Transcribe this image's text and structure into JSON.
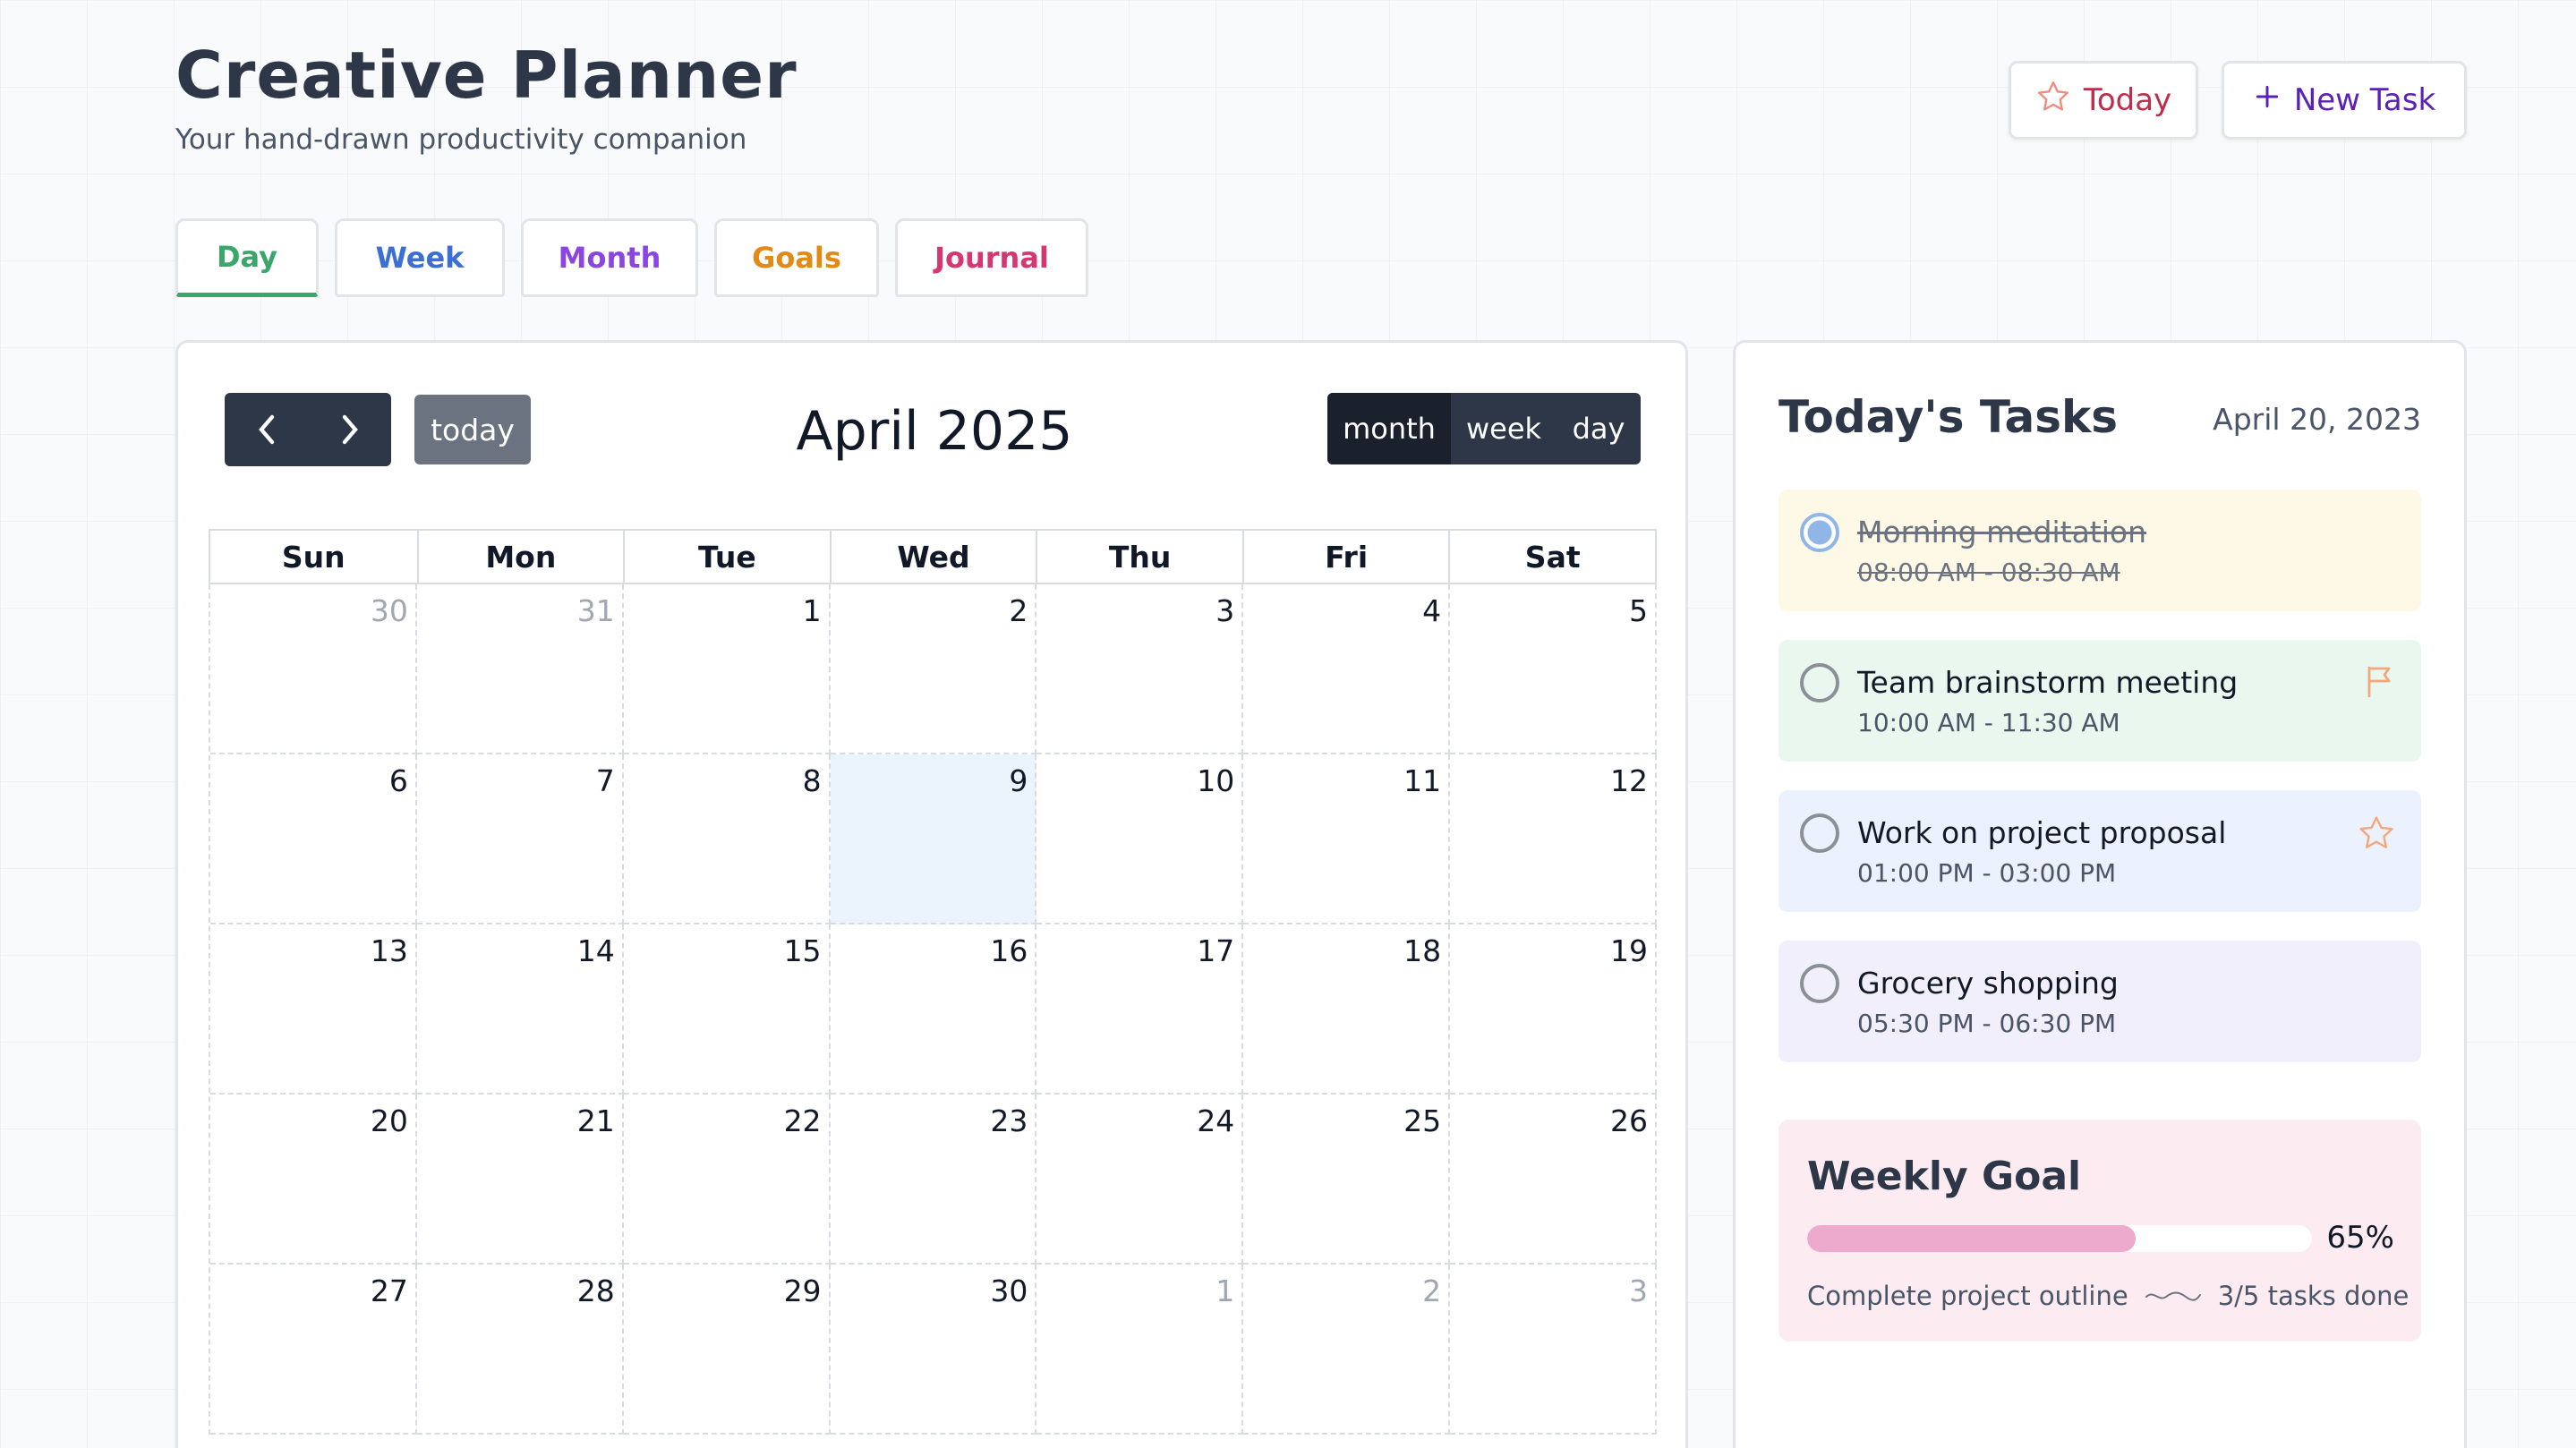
{
  "app": {
    "title": "Creative Planner",
    "subtitle": "Your hand-drawn productivity companion"
  },
  "header": {
    "today_label": "Today",
    "new_task_label": "New Task"
  },
  "tabs": [
    {
      "label": "Day",
      "active": true
    },
    {
      "label": "Week"
    },
    {
      "label": "Month"
    },
    {
      "label": "Goals"
    },
    {
      "label": "Journal"
    }
  ],
  "calendar": {
    "title": "April 2025",
    "today_label": "today",
    "views": [
      "month",
      "week",
      "day"
    ],
    "active_view": "month",
    "weekdays": [
      "Sun",
      "Mon",
      "Tue",
      "Wed",
      "Thu",
      "Fri",
      "Sat"
    ],
    "days": [
      {
        "n": "30",
        "other": true
      },
      {
        "n": "31",
        "other": true
      },
      {
        "n": "1"
      },
      {
        "n": "2"
      },
      {
        "n": "3"
      },
      {
        "n": "4"
      },
      {
        "n": "5"
      },
      {
        "n": "6"
      },
      {
        "n": "7"
      },
      {
        "n": "8"
      },
      {
        "n": "9",
        "highlight": true
      },
      {
        "n": "10"
      },
      {
        "n": "11"
      },
      {
        "n": "12"
      },
      {
        "n": "13"
      },
      {
        "n": "14"
      },
      {
        "n": "15"
      },
      {
        "n": "16"
      },
      {
        "n": "17"
      },
      {
        "n": "18"
      },
      {
        "n": "19"
      },
      {
        "n": "20"
      },
      {
        "n": "21"
      },
      {
        "n": "22"
      },
      {
        "n": "23"
      },
      {
        "n": "24"
      },
      {
        "n": "25"
      },
      {
        "n": "26"
      },
      {
        "n": "27"
      },
      {
        "n": "28"
      },
      {
        "n": "29"
      },
      {
        "n": "30"
      },
      {
        "n": "1",
        "other": true
      },
      {
        "n": "2",
        "other": true
      },
      {
        "n": "3",
        "other": true
      }
    ]
  },
  "tasks_panel": {
    "title": "Today's Tasks",
    "date": "April 20, 2023",
    "tasks": [
      {
        "name": "Morning meditation",
        "time": "08:00 AM - 08:30 AM",
        "done": true,
        "icon": ""
      },
      {
        "name": "Team brainstorm meeting",
        "time": "10:00 AM - 11:30 AM",
        "done": false,
        "icon": "flag-icon"
      },
      {
        "name": "Work on project proposal",
        "time": "01:00 PM - 03:00 PM",
        "done": false,
        "icon": "star-icon"
      },
      {
        "name": "Grocery shopping",
        "time": "05:30 PM - 06:30 PM",
        "done": false,
        "icon": ""
      }
    ]
  },
  "weekly_goal": {
    "title": "Weekly Goal",
    "progress": 0.65,
    "percent_label": "65%",
    "description": "Complete project outline",
    "status": "3/5 tasks done"
  },
  "colors": {
    "day": "#3aa66b",
    "week": "#3b6fd6",
    "month": "#8b45e0",
    "goals": "#e38a16",
    "journal": "#d63773",
    "dark": "#2d3748",
    "highlight_day": "#ebf3fd",
    "goal_fill": "#eeaacc"
  }
}
